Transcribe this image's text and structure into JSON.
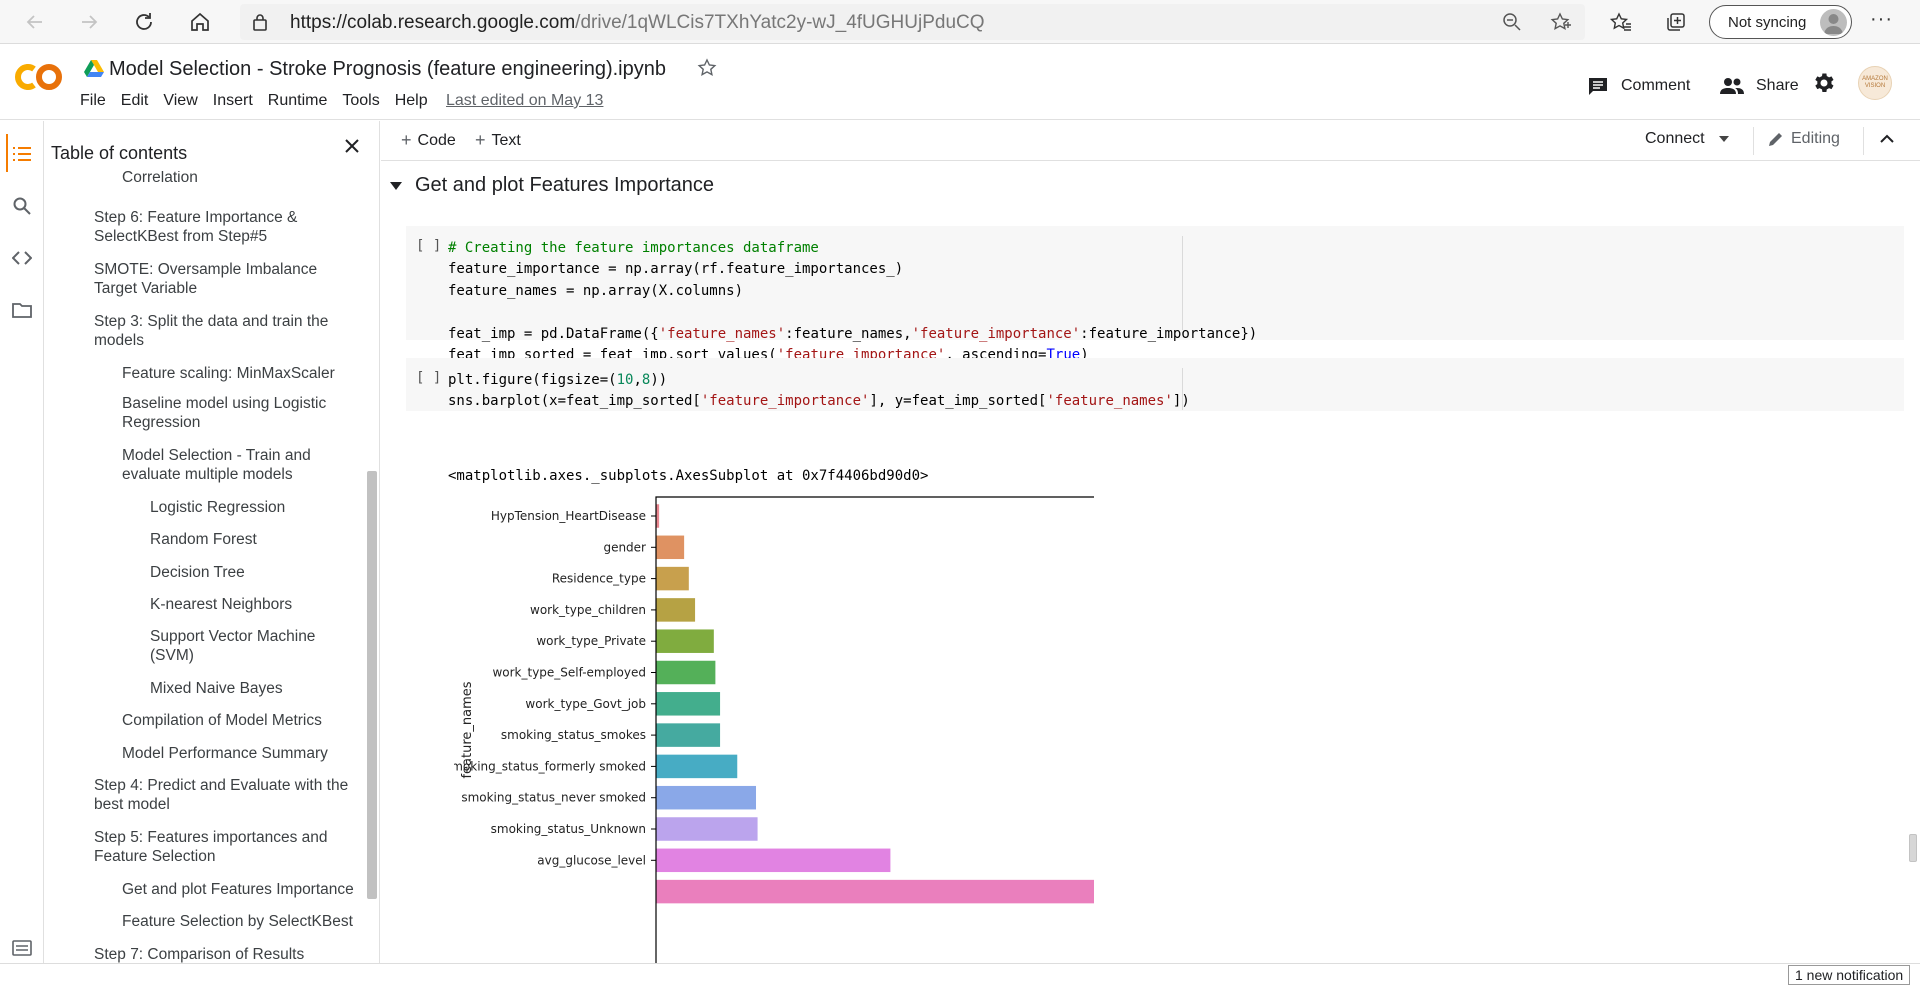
{
  "browser": {
    "url_host": "https://colab.research.google.com",
    "url_path": "/drive/1qWLCis7TXhYatc2y-wJ_4fUGHUjPduCQ",
    "profile_label": "Not syncing",
    "menu_label": "···"
  },
  "header": {
    "notebook_title": "Model Selection - Stroke Prognosis (feature engineering).ipynb",
    "menu": [
      "File",
      "Edit",
      "View",
      "Insert",
      "Runtime",
      "Tools",
      "Help"
    ],
    "last_edited": "Last edited on May 13",
    "comment_label": "Comment",
    "share_label": "Share",
    "avatar_text": "AMAZON VISION"
  },
  "toc": {
    "title": "Table of contents",
    "items": [
      {
        "text": "Filter Features by High Correlation",
        "level": 2
      },
      {
        "text": "Step 6: Feature Importance & SelectKBest from Step#5",
        "level": 1
      },
      {
        "text": "SMOTE: Oversample Imbalance Target Variable",
        "level": 1
      },
      {
        "text": "Step 3: Split the data and train the models",
        "level": 1
      },
      {
        "text": "Feature scaling: MinMaxScaler",
        "level": 2
      },
      {
        "text": "Baseline model using Logistic Regression",
        "level": 2
      },
      {
        "text": "Model Selection - Train and evaluate multiple models",
        "level": 2
      },
      {
        "text": "Logistic Regression",
        "level": 3
      },
      {
        "text": "Random Forest",
        "level": 3
      },
      {
        "text": "Decision Tree",
        "level": 3
      },
      {
        "text": "K-nearest Neighbors",
        "level": 3
      },
      {
        "text": "Support Vector Machine (SVM)",
        "level": 3
      },
      {
        "text": "Mixed Naive Bayes",
        "level": 3
      },
      {
        "text": "Compilation of Model Metrics",
        "level": 2
      },
      {
        "text": "Model Performance Summary",
        "level": 2
      },
      {
        "text": "Step 4: Predict and Evaluate with the best model",
        "level": 1
      },
      {
        "text": "Step 5: Features importances and Feature Selection",
        "level": 1
      },
      {
        "text": "Get and plot Features Importance",
        "level": 2
      },
      {
        "text": "Feature Selection by SelectKBest",
        "level": 2
      },
      {
        "text": "Step 7: Comparison of Results",
        "level": 1
      }
    ]
  },
  "toolbar": {
    "code_label": "Code",
    "text_label": "Text",
    "connect_label": "Connect",
    "editing_label": "Editing"
  },
  "notebook": {
    "section_title": "Get and plot Features Importance",
    "run_bracket": "[ ]",
    "output_repr": "<matplotlib.axes._subplots.AxesSubplot at 0x7f4406bd90d0>"
  },
  "status": {
    "notification": "1 new notification"
  },
  "chart_data": {
    "type": "bar",
    "orientation": "horizontal",
    "title": "",
    "xlabel": "",
    "ylabel": "feature_names",
    "categories": [
      "HypTension_HeartDisease",
      "gender",
      "Residence_type",
      "work_type_children",
      "work_type_Private",
      "work_type_Self-employed",
      "work_type_Govt_job",
      "smoking_status_smokes",
      "smoking_status_formerly smoked",
      "smoking_status_never smoked",
      "smoking_status_Unknown",
      "avg_glucose_level",
      ""
    ],
    "values": [
      0.002,
      0.018,
      0.021,
      0.025,
      0.037,
      0.038,
      0.041,
      0.041,
      0.052,
      0.064,
      0.065,
      0.15,
      0.31
    ],
    "xlim": [
      0,
      0.327
    ],
    "colors": [
      "#e8868f",
      "#df9262",
      "#c8a04d",
      "#b6a244",
      "#80ac3f",
      "#54b059",
      "#43ae8d",
      "#45aaa0",
      "#47acc4",
      "#8aa8e8",
      "#bba4ed",
      "#e183e2",
      "#ea7fbd"
    ],
    "grid": false,
    "legend": "none"
  }
}
